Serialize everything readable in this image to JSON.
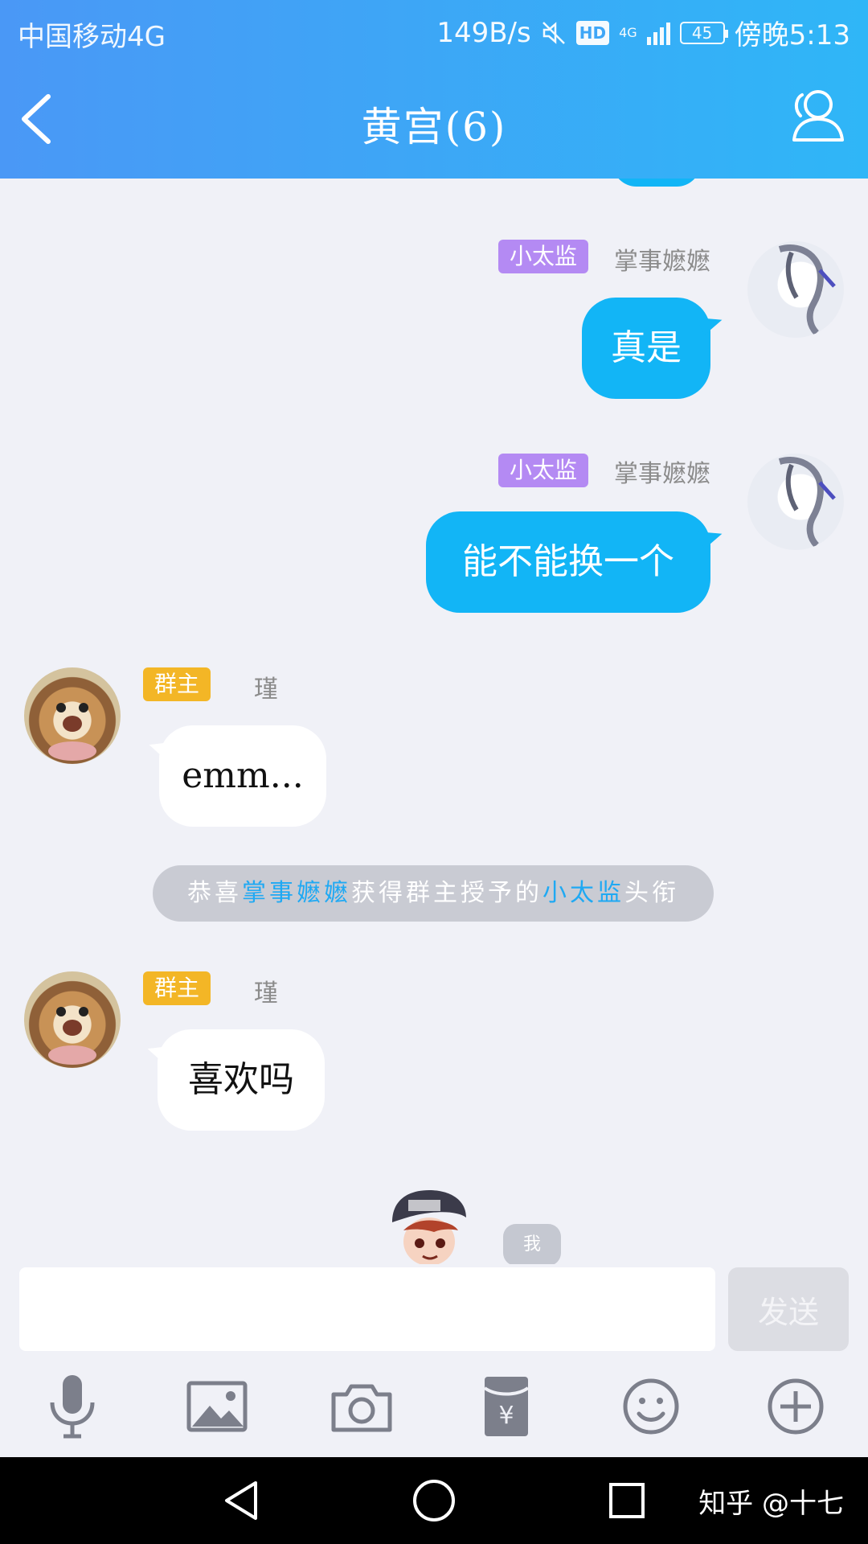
{
  "status_bar": {
    "carrier": "中国移动4G",
    "speed": "149B/s",
    "hd": "HD",
    "network": "4G",
    "battery": "45",
    "time": "傍晚5:13"
  },
  "header": {
    "title": "黄宫(6)"
  },
  "messages": [
    {
      "side": "right",
      "tag": "小太监",
      "nick": "掌事嬷嬷",
      "text": "真是"
    },
    {
      "side": "right",
      "tag": "小太监",
      "nick": "掌事嬷嬷",
      "text": "能不能换一个"
    },
    {
      "side": "left",
      "tag": "群主",
      "nick": "瑾",
      "text": "emm..."
    },
    {
      "side": "left",
      "tag": "群主",
      "nick": "瑾",
      "text": "喜欢吗"
    }
  ],
  "system_notice": {
    "prefix": "恭喜",
    "name": "掌事嬷嬷",
    "middle": "获得群主授予的",
    "title": "小太监",
    "suffix": "头衔"
  },
  "peek": {
    "label": "我"
  },
  "input": {
    "value": "",
    "placeholder": ""
  },
  "send_label": "发送",
  "toolbar": [
    "microphone-icon",
    "image-icon",
    "camera-icon",
    "red-packet-icon",
    "emoji-icon",
    "plus-icon"
  ],
  "watermark": "知乎 @十七",
  "colors": {
    "header_start": "#4a98f6",
    "header_end": "#2fb6f7",
    "bubble_blue": "#12b5f6",
    "tag_title": "#b48af3",
    "tag_owner": "#f3b626"
  }
}
